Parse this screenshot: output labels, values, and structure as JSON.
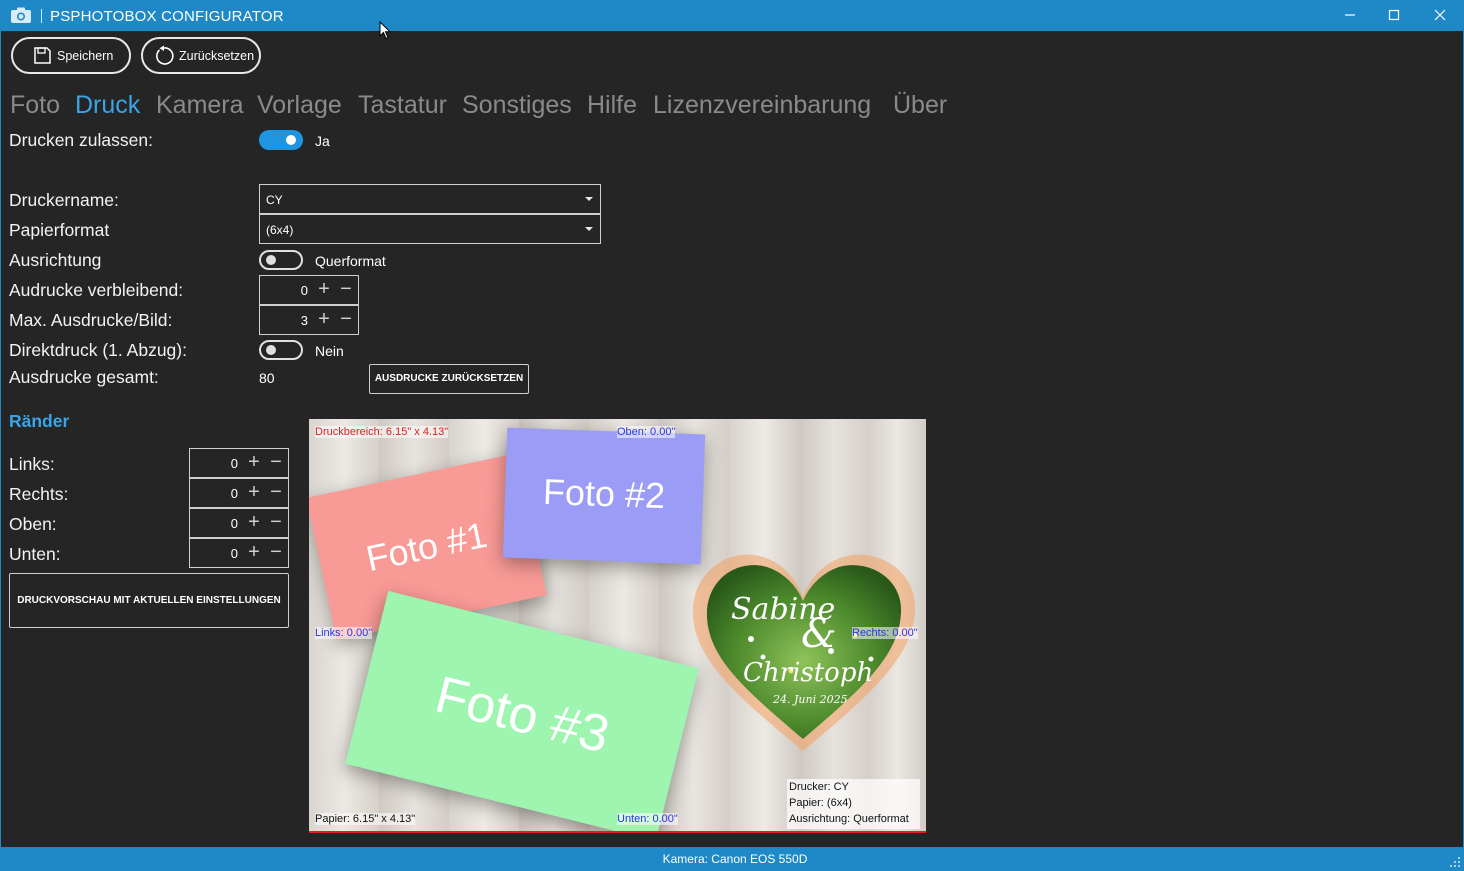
{
  "window": {
    "title": "PSPHOTOBOX CONFIGURATOR",
    "icon": "camera-icon"
  },
  "toolbar": {
    "save_label": "Speichern",
    "reset_label": "Zurücksetzen"
  },
  "tabs": [
    "Foto",
    "Druck",
    "Kamera",
    "Vorlage",
    "Tastatur",
    "Sonstiges",
    "Hilfe",
    "Lizenzvereinbarung",
    "Über"
  ],
  "active_tab": "Druck",
  "print": {
    "allow_label": "Drucken zulassen:",
    "allow_value": "Ja",
    "printer_label": "Druckername:",
    "printer_value": "CY",
    "paper_label": "Papierformat",
    "paper_value": "(6x4)",
    "orientation_label": "Ausrichtung",
    "orientation_value": "Querformat",
    "remaining_label": "Audrucke verbleibend:",
    "remaining_value": "0",
    "max_label": "Max. Ausdrucke/Bild:",
    "max_value": "3",
    "direct_label": "Direktdruck (1. Abzug):",
    "direct_value": "Nein",
    "total_label": "Ausdrucke gesamt:",
    "total_value": "80",
    "reset_counts_label": "AUSDRUCKE ZURÜCKSETZEN"
  },
  "margins": {
    "heading": "Ränder",
    "left_label": "Links:",
    "left_value": "0",
    "right_label": "Rechts:",
    "right_value": "0",
    "top_label": "Oben:",
    "top_value": "0",
    "bottom_label": "Unten:",
    "bottom_value": "0",
    "preview_button": "DRUCKVORSCHAU MIT AKTUELLEN EINSTELLUNGEN"
  },
  "preview": {
    "print_area": "Druckbereich: 6.15\" x 4.13\"",
    "top": "Oben: 0.00\"",
    "left": "Links: 0.00\"",
    "right": "Rechts: 0.00\"",
    "bottom": "Unten: 0.00\"",
    "paper": "Papier: 6.15\" x 4.13\"",
    "info_printer": "Drucker: CY",
    "info_paper": "Papier: (6x4)",
    "info_orientation": "Ausrichtung: Querformat",
    "photo1": "Foto #1",
    "photo2": "Foto #2",
    "photo3": "Foto #3",
    "heart_name1": "Sabine",
    "heart_amp": "&",
    "heart_name2": "Christoph",
    "heart_date": "24. Juni 2025"
  },
  "statusbar": {
    "camera": "Kamera: Canon EOS 550D"
  },
  "colors": {
    "accent": "#1f89c7",
    "active_tab": "#3aa4e6",
    "photo1": "#f89a96",
    "photo2": "#9b9cf5",
    "photo3": "#9df5b0",
    "guide_red": "#e02020",
    "guide_blue": "#2a36e0"
  }
}
